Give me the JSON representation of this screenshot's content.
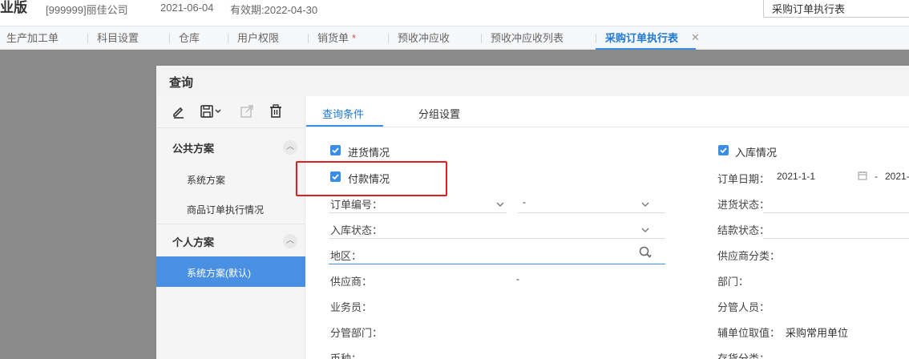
{
  "header": {
    "brand": "业版",
    "company": "[999999]丽佳公司",
    "date": "2021-06-04",
    "validity": "有效期:2022-04-30",
    "search_value": "采购订单执行表"
  },
  "tabs": [
    {
      "label": "生产加工单"
    },
    {
      "label": "科目设置"
    },
    {
      "label": "仓库"
    },
    {
      "label": "用户权限"
    },
    {
      "label": "销货单",
      "marker": "*"
    },
    {
      "label": "预收冲应收"
    },
    {
      "label": "预收冲应收列表"
    },
    {
      "label": "采购订单执行表",
      "active": true
    }
  ],
  "dialog": {
    "title": "查询",
    "toolbar_icons": [
      "edit-icon",
      "save-icon",
      "export-icon",
      "delete-icon"
    ],
    "public_section": "公共方案",
    "public_plans": [
      "系统方案",
      "商品订单执行情况"
    ],
    "personal_section": "个人方案",
    "personal_plans": [
      "系统方案(默认)"
    ],
    "right_tabs": [
      "查询条件",
      "分组设置"
    ],
    "left_col": {
      "chk_purchase": "进货情况",
      "chk_payment": "付款情况",
      "order_no": "订单编号：",
      "order_no_sep": "-",
      "stock_in_status": "入库状态：",
      "region": "地区：",
      "supplier": "供应商：",
      "supplier_sep": "-",
      "salesperson": "业务员：",
      "dept_in_charge": "分管部门：",
      "currency": "币种："
    },
    "right_col": {
      "chk_stock_in": "入库情况",
      "order_date": "订单日期：",
      "order_date_from": "2021-1-1",
      "order_date_sep": "-",
      "order_date_to": "2021-",
      "purchase_status": "进货状态：",
      "settlement_status": "结款状态：",
      "supplier_category": "供应商分类：",
      "department": "部门：",
      "staff_in_charge": "分管人员：",
      "aux_unit": "辅单位取值：",
      "aux_unit_value": "采购常用单位",
      "inventory_category": "存货分类："
    }
  },
  "colors": {
    "accent": "#3a8ee6",
    "highlight_box": "#e02020",
    "selected_plan": "#4a90e2"
  }
}
